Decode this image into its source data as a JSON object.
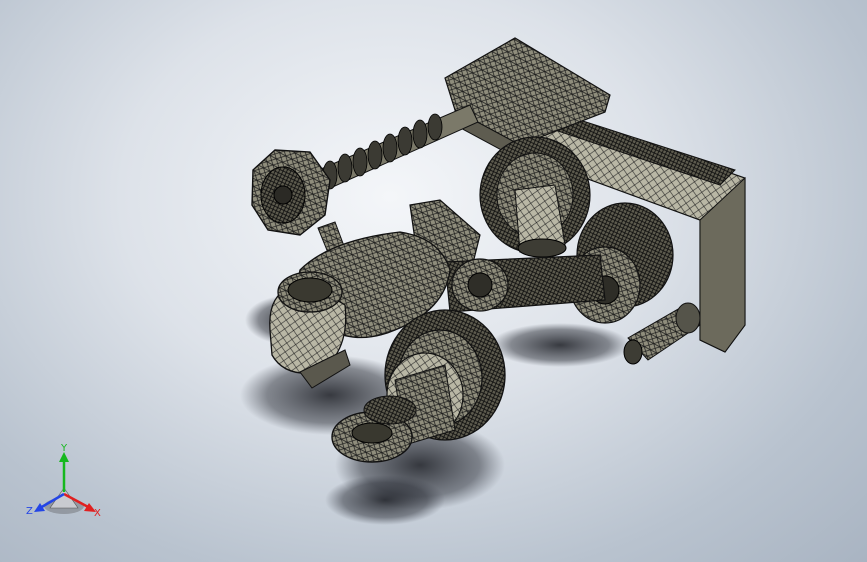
{
  "viewport": {
    "background_top": "#f4f6f9",
    "background_bottom": "#a9b4c2",
    "model_fill": "#8e8c7a",
    "model_wire": "#111111"
  },
  "triad": {
    "y_label": "Y",
    "z_label": "Z",
    "x_label": "X",
    "y_color": "#16b81e",
    "z_color": "#2345e6",
    "x_color": "#e02020"
  }
}
